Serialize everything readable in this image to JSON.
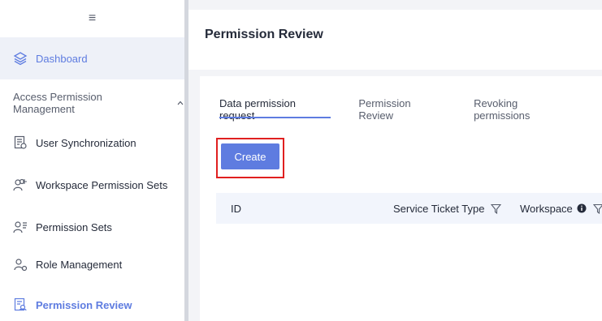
{
  "sidebar": {
    "collapse_glyph": "≡",
    "dashboard": {
      "label": "Dashboard",
      "icon": "layers-icon"
    },
    "group": {
      "label": "Access Permission Management",
      "icon": "chevron-up-icon"
    },
    "items": [
      {
        "label": "User Synchronization",
        "icon": "user-sync-icon"
      },
      {
        "label": "Workspace Permission Sets",
        "icon": "workspace-permission-icon"
      },
      {
        "label": "Permission Sets",
        "icon": "permission-sets-icon"
      },
      {
        "label": "Role Management",
        "icon": "role-management-icon"
      },
      {
        "label": "Permission Review",
        "icon": "permission-review-icon",
        "selected": true
      }
    ]
  },
  "header": {
    "title": "Permission Review"
  },
  "tabs": [
    {
      "label": "Data permission request",
      "active": true
    },
    {
      "label": "Permission Review",
      "active": false
    },
    {
      "label": "Revoking permissions",
      "active": false
    }
  ],
  "actions": {
    "create_label": "Create"
  },
  "table": {
    "columns": [
      {
        "label": "ID"
      },
      {
        "label": "Service Ticket Type",
        "icon": "filter-icon"
      },
      {
        "label": "Workspace",
        "icon": "filter-icon",
        "info_icon": "info-icon"
      }
    ]
  },
  "colors": {
    "accent": "#5e7ce0",
    "highlight_border": "#e02020",
    "header_row": "#f2f5fc"
  }
}
